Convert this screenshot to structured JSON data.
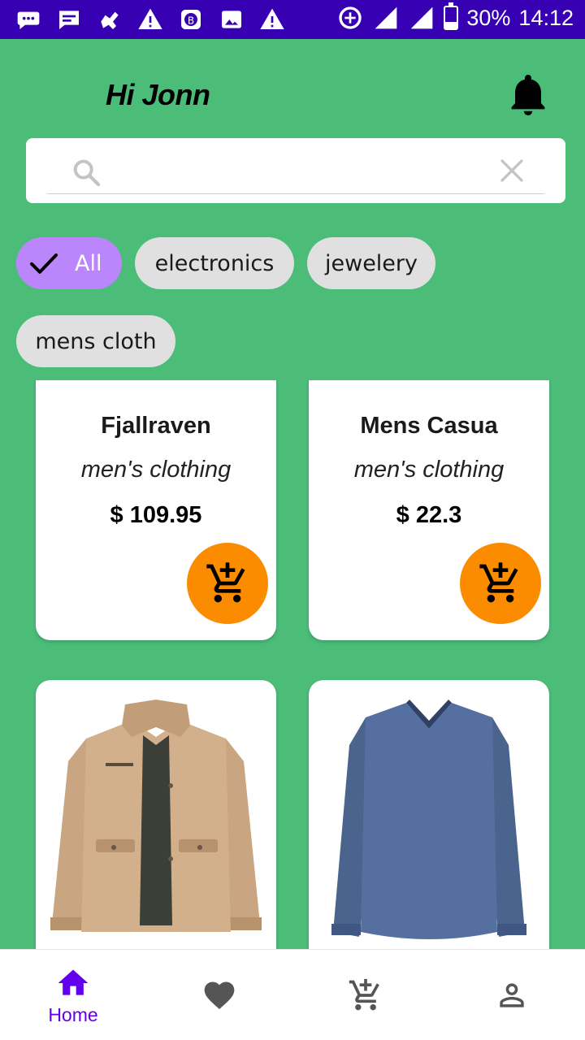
{
  "status_bar": {
    "battery_percent": "30%",
    "battery_level": 0.3,
    "time": "14:12",
    "network": "3G",
    "icons": [
      "chat-icon",
      "message-icon",
      "robot-icon",
      "warning-icon",
      "b-app-icon",
      "image-icon",
      "warning-icon",
      "data-saver-icon",
      "signal-icon",
      "signal-3g-icon",
      "battery-icon"
    ]
  },
  "header": {
    "greeting": "Hi Jonn",
    "notification_icon": "bell-icon"
  },
  "search": {
    "value": "",
    "placeholder": "",
    "search_icon": "search-icon",
    "clear_icon": "close-icon"
  },
  "filters": {
    "chips": [
      {
        "label": "All",
        "selected": true
      },
      {
        "label": "electronics",
        "selected": false
      },
      {
        "label": "jewelery",
        "selected": false
      },
      {
        "label": "mens cloth",
        "selected": false
      }
    ]
  },
  "products": [
    {
      "title": "Fjallraven",
      "category": "men's clothing",
      "price": "$ 109.95",
      "action_icon": "add-to-cart-icon"
    },
    {
      "title": "Mens Casua",
      "category": "men's clothing",
      "price": "$ 22.3",
      "action_icon": "add-to-cart-icon"
    },
    {
      "title": "",
      "category": "",
      "price": "",
      "image": "khaki-jacket"
    },
    {
      "title": "",
      "category": "",
      "price": "",
      "image": "blue-long-sleeve-shirt"
    }
  ],
  "bottom_nav": {
    "items": [
      {
        "label": "Home",
        "icon": "home-icon",
        "active": true
      },
      {
        "label": "",
        "icon": "heart-icon",
        "active": false
      },
      {
        "label": "",
        "icon": "add-to-cart-icon",
        "active": false
      },
      {
        "label": "",
        "icon": "person-icon",
        "active": false
      }
    ]
  },
  "colors": {
    "background": "#4bbd79",
    "status_bar": "#3700b3",
    "selected_chip": "#bb86fc",
    "cart_button": "#fb8c00",
    "nav_active": "#6200ee"
  }
}
